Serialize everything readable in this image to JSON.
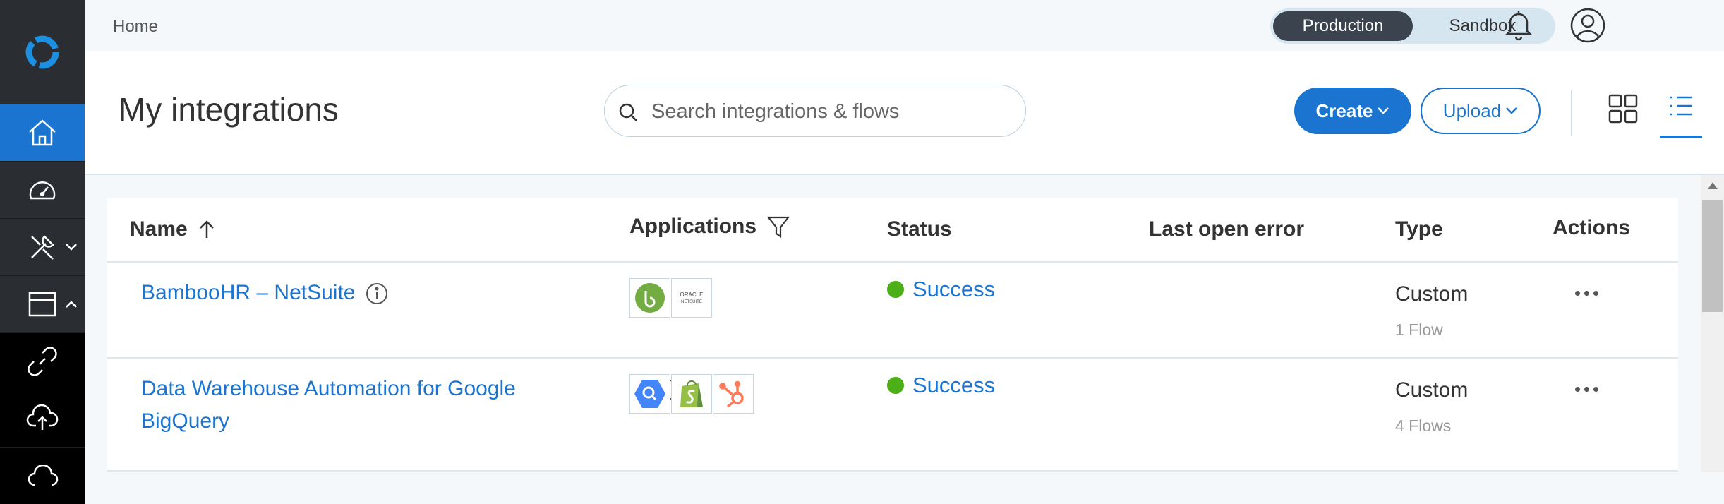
{
  "topbar": {
    "breadcrumb": "Home",
    "environment": {
      "production_label": "Production",
      "sandbox_label": "Sandbox"
    }
  },
  "header": {
    "title": "My integrations",
    "search_placeholder": "Search integrations & flows",
    "create_label": "Create",
    "upload_label": "Upload"
  },
  "table": {
    "columns": {
      "name": "Name",
      "applications": "Applications",
      "status": "Status",
      "last_open_error": "Last open error",
      "type": "Type",
      "actions": "Actions"
    },
    "rows": [
      {
        "name": "BambooHR – NetSuite",
        "apps": [
          "bamboohr-logo",
          "oracle-netsuite-logo"
        ],
        "status": "Success",
        "last_open_error": "",
        "type": "Custom",
        "flows": "1 Flow"
      },
      {
        "name_line1": "Data Warehouse Automation for Google",
        "name_line2": "BigQuery",
        "apps": [
          "google-bigquery-logo",
          "shopify-logo",
          "hubspot-logo"
        ],
        "status": "Success",
        "last_open_error": "",
        "type": "Custom",
        "flows": "4 Flows"
      }
    ]
  },
  "app_logos": {
    "oracle_line1": "ORACLE",
    "oracle_line2": "NETSUITE"
  },
  "colors": {
    "accent": "#1b75d0",
    "sidebar": "#2a2d32",
    "success": "#4caf17"
  }
}
